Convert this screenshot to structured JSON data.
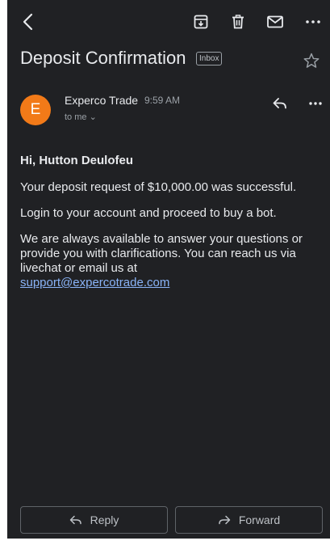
{
  "toolbar": {
    "icons": [
      "back-icon",
      "archive-icon",
      "delete-icon",
      "mark-unread-icon",
      "more-icon"
    ]
  },
  "email": {
    "subject": "Deposit Confirmation",
    "label": "Inbox",
    "sender_name": "Experco Trade",
    "sender_initial": "E",
    "time": "9:59 AM",
    "recipient": "to me ⌄",
    "greeting": "Hi, Hutton Deulofeu",
    "paragraph_1": "Your deposit request of $10,000.00 was successful.",
    "paragraph_2": "Login to your account and proceed to buy a bot.",
    "paragraph_3": "We are always available to answer your questions or provide you with clarifications. You can reach us via livechat or email us at",
    "support_email": "support@expercotrade.com"
  },
  "actions": {
    "reply_label": "Reply",
    "forward_label": "Forward"
  },
  "colors": {
    "background": "#202124",
    "avatar": "#f27a18",
    "link": "#8ab4f8",
    "text": "#e8eaed",
    "muted": "#9aa0a6"
  }
}
